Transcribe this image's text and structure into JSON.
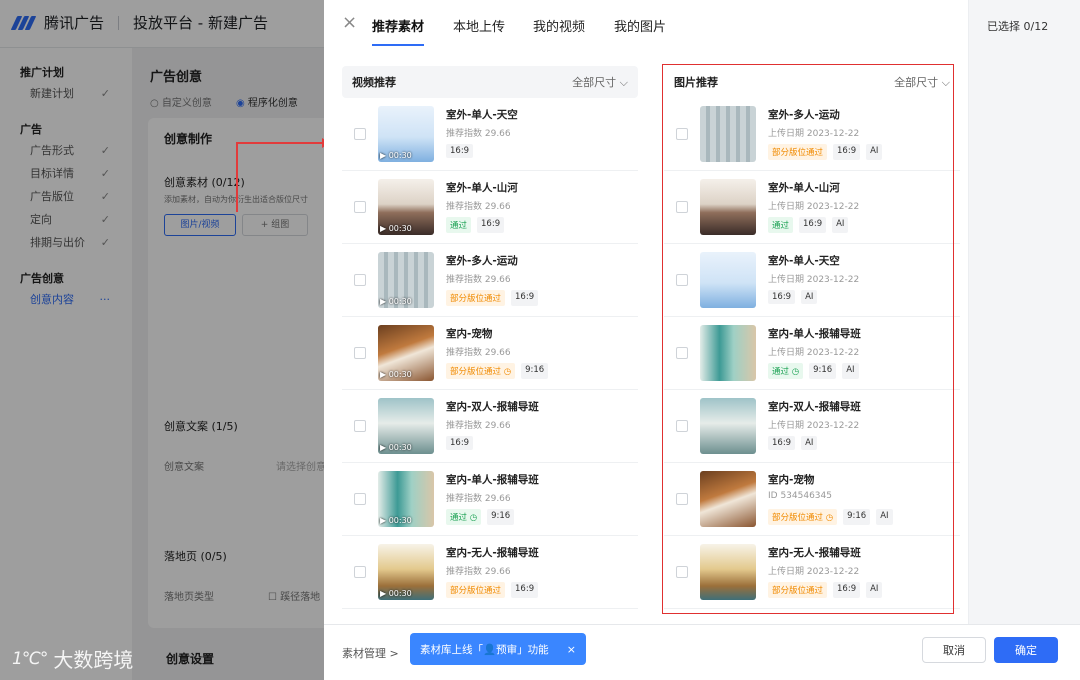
{
  "app": {
    "brand": "腾讯广告",
    "platform": "投放平台 - 新建广告"
  },
  "sidebar": {
    "groups": [
      {
        "title": "推广计划",
        "items": [
          {
            "label": "新建计划",
            "check": "✓"
          }
        ]
      },
      {
        "title": "广告",
        "items": [
          {
            "label": "广告形式",
            "check": "✓"
          },
          {
            "label": "目标详情",
            "check": "✓"
          },
          {
            "label": "广告版位",
            "check": "✓"
          },
          {
            "label": "定向",
            "check": "✓"
          },
          {
            "label": "排期与出价",
            "check": "✓"
          }
        ]
      },
      {
        "title": "广告创意",
        "items": [
          {
            "label": "创意内容",
            "check": "···"
          }
        ]
      }
    ]
  },
  "background": {
    "section_title": "广告创意",
    "radio_custom": "自定义创意",
    "radio_program": "程序化创意",
    "card_title": "创意制作",
    "material_title": "创意素材 (0/12)",
    "material_hint": "添加素材，自动为你衍生出适合版位尺寸",
    "btn_media": "图片/视频",
    "btn_group": "+ 组图",
    "copy_title": "创意文案 (1/5)",
    "copy_label": "创意文案",
    "copy_placeholder": "请选择创意",
    "landing_title": "落地页 (0/5)",
    "landing_label": "落地页类型",
    "landing_opt": "蹊径落地",
    "settings_title": "创意设置"
  },
  "watermark": {
    "mark": "1℃°",
    "text": "大数跨境"
  },
  "drawer": {
    "close_icon": "×",
    "tabs": [
      "推荐素材",
      "本地上传",
      "我的视频",
      "我的图片"
    ],
    "selected": "已选择 0/12",
    "video": {
      "title": "视频推荐",
      "size_filter": "全部尺寸 ⌵",
      "items": [
        {
          "name": "室外-单人-天空",
          "meta": "推荐指数 29.66",
          "duration": "▶ 00:30",
          "thumb": "sky",
          "tags": [
            {
              "t": "16:9",
              "k": "n"
            }
          ]
        },
        {
          "name": "室外-单人-山河",
          "meta": "推荐指数 29.66",
          "duration": "▶ 00:30",
          "thumb": "mountain",
          "tags": [
            {
              "t": "通过",
              "k": "pass"
            },
            {
              "t": "16:9",
              "k": "n"
            }
          ]
        },
        {
          "name": "室外-多人-运动",
          "meta": "推荐指数 29.66",
          "duration": "▶ 00:30",
          "thumb": "sport",
          "tags": [
            {
              "t": "部分版位通过",
              "k": "part"
            },
            {
              "t": "16:9",
              "k": "n"
            }
          ]
        },
        {
          "name": "室内-宠物",
          "meta": "推荐指数 29.66",
          "duration": "▶ 00:30",
          "thumb": "dog",
          "tags": [
            {
              "t": "部分版位通过 ◷",
              "k": "part"
            },
            {
              "t": "9:16",
              "k": "n"
            }
          ]
        },
        {
          "name": "室内-双人-报辅导班",
          "meta": "推荐指数 29.66",
          "duration": "▶ 00:30",
          "thumb": "desk",
          "tags": [
            {
              "t": "16:9",
              "k": "n"
            }
          ]
        },
        {
          "name": "室内-单人-报辅导班",
          "meta": "推荐指数 29.66",
          "duration": "▶ 00:30",
          "thumb": "chair",
          "tags": [
            {
              "t": "通过 ◷",
              "k": "pass"
            },
            {
              "t": "9:16",
              "k": "n"
            }
          ]
        },
        {
          "name": "室内-无人-报辅导班",
          "meta": "推荐指数 29.66",
          "duration": "▶ 00:30",
          "thumb": "food",
          "tags": [
            {
              "t": "部分版位通过",
              "k": "part"
            },
            {
              "t": "16:9",
              "k": "n"
            }
          ]
        }
      ]
    },
    "image": {
      "title": "图片推荐",
      "size_filter": "全部尺寸 ⌵",
      "items": [
        {
          "name": "室外-多人-运动",
          "meta": "上传日期 2023-12-22",
          "thumb": "sport",
          "tags": [
            {
              "t": "部分版位通过",
              "k": "part"
            },
            {
              "t": "16:9",
              "k": "n"
            },
            {
              "t": "AI",
              "k": "n"
            }
          ]
        },
        {
          "name": "室外-单人-山河",
          "meta": "上传日期 2023-12-22",
          "thumb": "mountain",
          "tags": [
            {
              "t": "通过",
              "k": "pass"
            },
            {
              "t": "16:9",
              "k": "n"
            },
            {
              "t": "AI",
              "k": "n"
            }
          ]
        },
        {
          "name": "室外-单人-天空",
          "meta": "上传日期 2023-12-22",
          "thumb": "sky",
          "tags": [
            {
              "t": "16:9",
              "k": "n"
            },
            {
              "t": "AI",
              "k": "n"
            }
          ]
        },
        {
          "name": "室内-单人-报辅导班",
          "meta": "上传日期 2023-12-22",
          "thumb": "chair",
          "tags": [
            {
              "t": "通过 ◷",
              "k": "pass"
            },
            {
              "t": "9:16",
              "k": "n"
            },
            {
              "t": "AI",
              "k": "n"
            }
          ]
        },
        {
          "name": "室内-双人-报辅导班",
          "meta": "上传日期 2023-12-22",
          "thumb": "desk",
          "tags": [
            {
              "t": "16:9",
              "k": "n"
            },
            {
              "t": "AI",
              "k": "n"
            }
          ]
        },
        {
          "name": "室内-宠物",
          "meta": "ID 534546345",
          "thumb": "dog",
          "tags": [
            {
              "t": "部分版位通过 ◷",
              "k": "part"
            },
            {
              "t": "9:16",
              "k": "n"
            },
            {
              "t": "AI",
              "k": "n"
            }
          ]
        },
        {
          "name": "室内-无人-报辅导班",
          "meta": "上传日期 2023-12-22",
          "thumb": "food",
          "tags": [
            {
              "t": "部分版位通过",
              "k": "part"
            },
            {
              "t": "16:9",
              "k": "n"
            },
            {
              "t": "AI",
              "k": "n"
            }
          ]
        }
      ]
    },
    "footer": {
      "material_mgmt": "素材管理 >",
      "toast_text": "素材库上线「",
      "toast_icon": "👤",
      "toast_text2": "预审」功能",
      "toast_close": "×",
      "cancel": "取消",
      "confirm": "确定"
    }
  },
  "colors": {
    "accent": "#2e6cf6",
    "highlight": "#e03030",
    "pass": "#1aa152",
    "partial": "#f08a00"
  }
}
